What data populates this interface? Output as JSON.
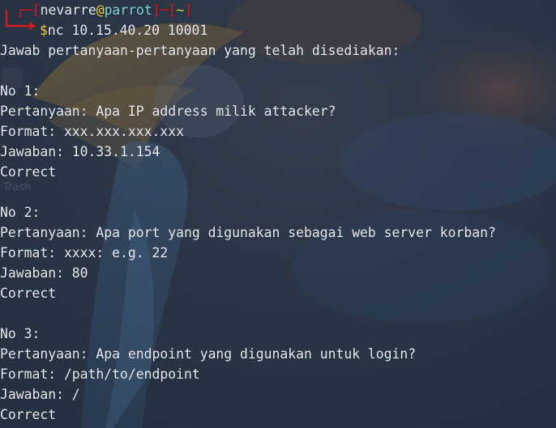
{
  "prompt": {
    "open_bracket": "┌─[",
    "user": "nevarre",
    "at": "@",
    "host": "parrot",
    "separator": "]─[",
    "cwd": "~",
    "close_bracket": "]",
    "dollar": "$",
    "command": "nc 10.15.40.20 10001"
  },
  "desktop": {
    "trash_label": "Trash"
  },
  "output": {
    "intro": "Jawab pertanyaan-pertanyaan yang telah disediakan:",
    "questions": [
      {
        "number": "No 1:",
        "question": "Pertanyaan: Apa IP address milik attacker?",
        "format": "Format: xxx.xxx.xxx.xxx",
        "answer": "Jawaban: 10.33.1.154",
        "result": "Correct"
      },
      {
        "number": "No 2:",
        "question": "Pertanyaan: Apa port yang digunakan sebagai web server korban?",
        "format": "Format: xxxx: e.g. 22",
        "answer": "Jawaban: 80",
        "result": "Correct"
      },
      {
        "number": "No 3:",
        "question": "Pertanyaan: Apa endpoint yang digunakan untuk login?",
        "format": "Format: /path/to/endpoint",
        "answer": "Jawaban: /",
        "result": "Correct"
      }
    ]
  },
  "colors": {
    "prompt_red": "#d71921",
    "prompt_yellow": "#f2d13b",
    "prompt_cyan": "#7fd6d8",
    "text": "#e8ebf0",
    "background": "#2b3646"
  }
}
